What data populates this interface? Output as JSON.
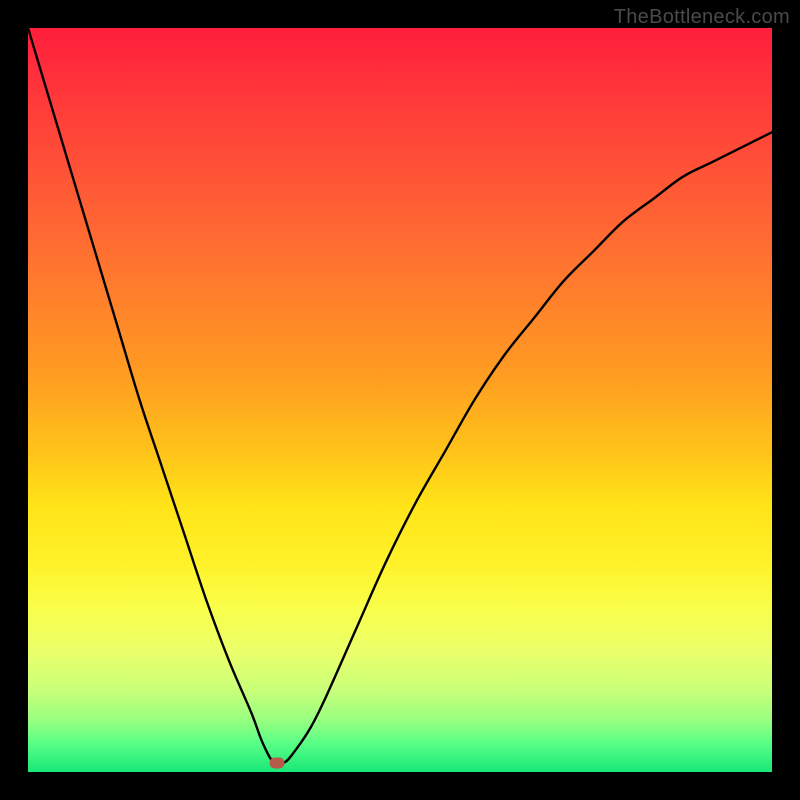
{
  "watermark": "TheBottleneck.com",
  "chart_data": {
    "type": "line",
    "title": "",
    "xlabel": "",
    "ylabel": "",
    "xlim": [
      0,
      1
    ],
    "ylim": [
      0,
      1
    ],
    "series": [
      {
        "name": "bottleneck-curve",
        "x": [
          0.0,
          0.03,
          0.06,
          0.09,
          0.12,
          0.15,
          0.18,
          0.21,
          0.24,
          0.27,
          0.3,
          0.315,
          0.33,
          0.345,
          0.36,
          0.38,
          0.4,
          0.44,
          0.48,
          0.52,
          0.56,
          0.6,
          0.64,
          0.68,
          0.72,
          0.76,
          0.8,
          0.84,
          0.88,
          0.92,
          0.96,
          1.0
        ],
        "y": [
          1.0,
          0.9,
          0.8,
          0.7,
          0.6,
          0.5,
          0.41,
          0.32,
          0.23,
          0.15,
          0.08,
          0.04,
          0.013,
          0.013,
          0.03,
          0.06,
          0.1,
          0.19,
          0.28,
          0.36,
          0.43,
          0.5,
          0.56,
          0.61,
          0.66,
          0.7,
          0.74,
          0.77,
          0.8,
          0.82,
          0.84,
          0.86
        ]
      }
    ],
    "marker": {
      "x": 0.335,
      "y": 0.012
    },
    "gradient_stops": [
      {
        "p": 0,
        "c": "#ff1e3c"
      },
      {
        "p": 50,
        "c": "#ffbf1a"
      },
      {
        "p": 75,
        "c": "#fff22a"
      },
      {
        "p": 100,
        "c": "#18e879"
      }
    ]
  }
}
